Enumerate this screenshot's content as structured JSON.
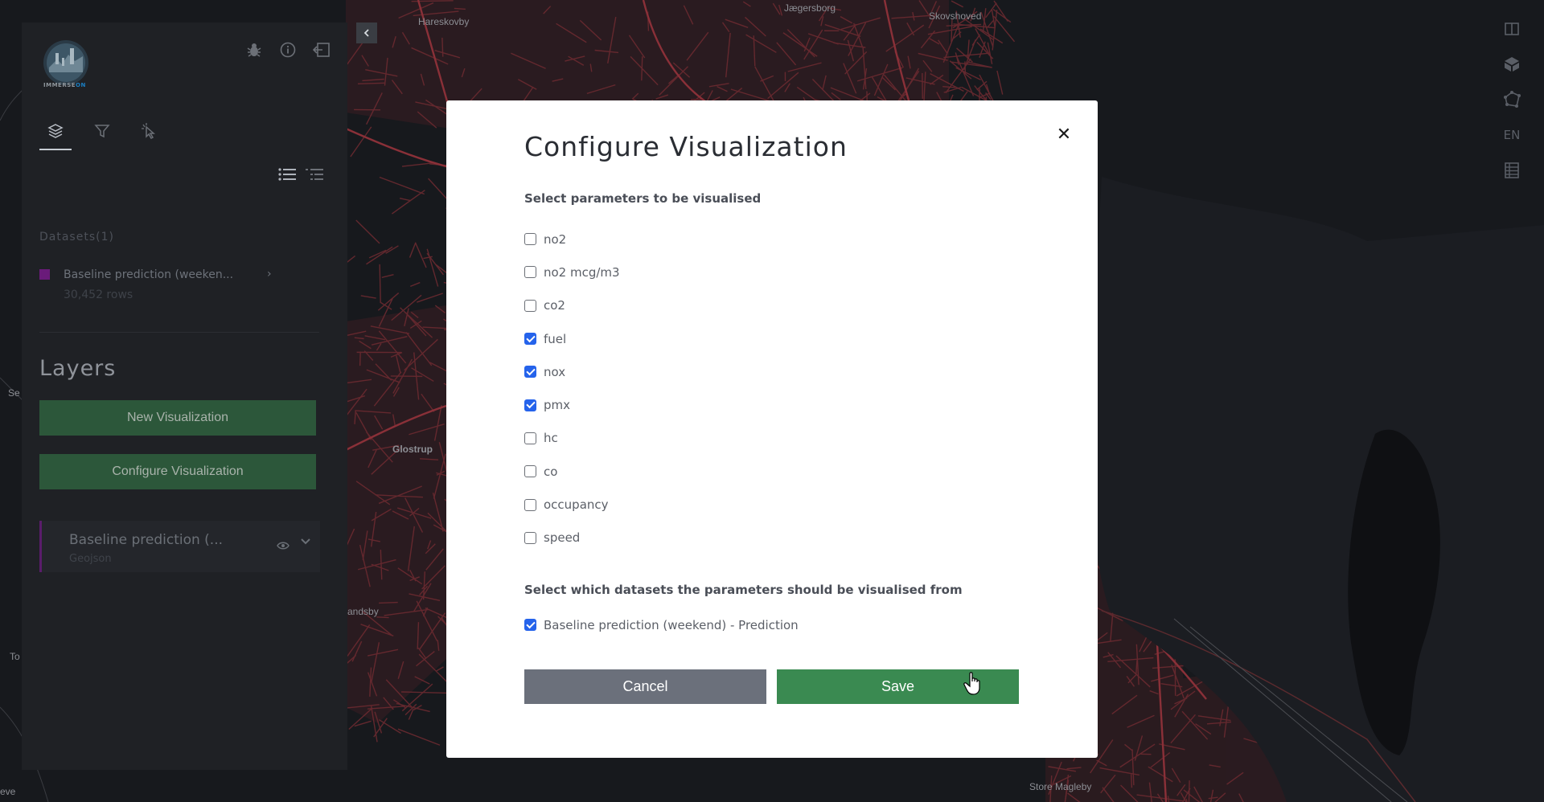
{
  "map": {
    "labels": [
      "Hareskovby",
      "Jægersborg",
      "Skovshoved",
      "Glostrup",
      "Store Magleby",
      "andsby",
      "To",
      "eve",
      "Se"
    ]
  },
  "right_toolbar": {
    "language": "EN",
    "icons": [
      "split-view-icon",
      "3d-cube-icon",
      "polygon-draw-icon",
      "language-switch",
      "table-icon"
    ]
  },
  "side_panel": {
    "logo_text_a": "IMMERSE",
    "logo_text_b": "ON",
    "datasets_title": "Datasets(1)",
    "dataset": {
      "name": "Baseline prediction (weeken...",
      "rows": "30,452 rows",
      "color": "#6a1b7a"
    },
    "layers_title": "Layers",
    "new_vis_label": "New Visualization",
    "config_vis_label": "Configure Visualization",
    "layer": {
      "name": "Baseline prediction (...",
      "type": "Geojson"
    }
  },
  "modal": {
    "title": "Configure Visualization",
    "params_label": "Select parameters to be visualised",
    "parameters": [
      {
        "label": "no2",
        "checked": false
      },
      {
        "label": "no2 mcg/m3",
        "checked": false
      },
      {
        "label": "co2",
        "checked": false
      },
      {
        "label": "fuel",
        "checked": true
      },
      {
        "label": "nox",
        "checked": true
      },
      {
        "label": "pmx",
        "checked": true
      },
      {
        "label": "hc",
        "checked": false
      },
      {
        "label": "co",
        "checked": false
      },
      {
        "label": "occupancy",
        "checked": false
      },
      {
        "label": "speed",
        "checked": false
      }
    ],
    "datasets_label": "Select which datasets the parameters should be visualised from",
    "datasets": [
      {
        "label": "Baseline prediction (weekend) - Prediction",
        "checked": true
      }
    ],
    "cancel_label": "Cancel",
    "save_label": "Save"
  },
  "colors": {
    "accent_blue": "#2563eb",
    "save_green": "#3a8a51",
    "cancel_gray": "#6b707b"
  }
}
